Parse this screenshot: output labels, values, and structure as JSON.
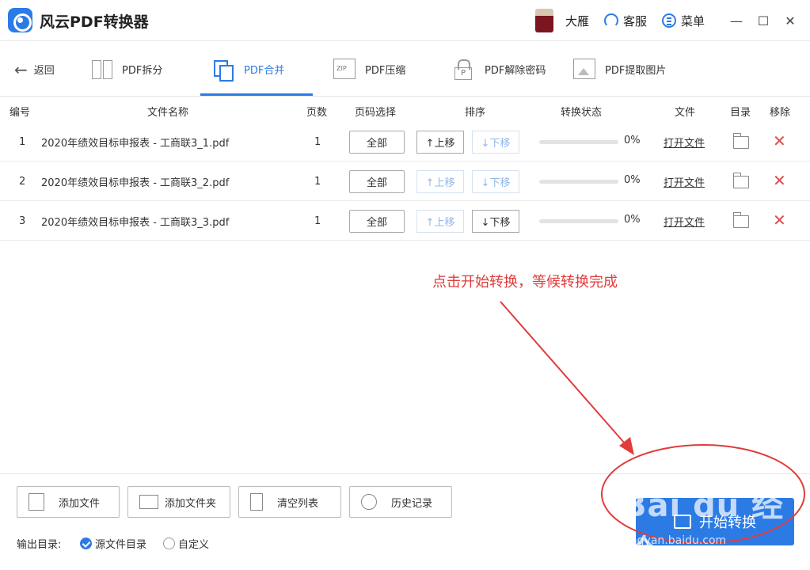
{
  "app": {
    "title": "风云PDF转换器",
    "user_name": "大雁",
    "service_label": "客服",
    "menu_label": "菜单",
    "minimize": "—",
    "maximize": "☐",
    "close": "✕"
  },
  "toolbar": {
    "back_label": "返回",
    "tabs": [
      {
        "label": "PDF拆分",
        "icon": "split-icon"
      },
      {
        "label": "PDF合并",
        "icon": "merge-icon",
        "active": true
      },
      {
        "label": "PDF压缩",
        "icon": "zip-icon"
      },
      {
        "label": "PDF解除密码",
        "icon": "lock-icon"
      },
      {
        "label": "PDF提取图片",
        "icon": "image-icon"
      }
    ]
  },
  "table": {
    "headers": {
      "index": "编号",
      "name": "文件名称",
      "pages": "页数",
      "page_select": "页码选择",
      "sort": "排序",
      "status": "转换状态",
      "file": "文件",
      "dir": "目录",
      "remove": "移除"
    },
    "rows": [
      {
        "index": "1",
        "name": "2020年绩效目标申报表 - 工商联3_1.pdf",
        "pages": "1",
        "page_select": "全部",
        "up": "↑上移",
        "down": "↓下移",
        "progress": 0,
        "percent": "0%",
        "open": "打开文件",
        "up_enabled": true,
        "down_enabled": false
      },
      {
        "index": "2",
        "name": "2020年绩效目标申报表 - 工商联3_2.pdf",
        "pages": "1",
        "page_select": "全部",
        "up": "↑上移",
        "down": "↓下移",
        "progress": 0,
        "percent": "0%",
        "open": "打开文件",
        "up_enabled": false,
        "down_enabled": false
      },
      {
        "index": "3",
        "name": "2020年绩效目标申报表 - 工商联3_3.pdf",
        "pages": "1",
        "page_select": "全部",
        "up": "↑上移",
        "down": "↓下移",
        "progress": 0,
        "percent": "0%",
        "open": "打开文件",
        "up_enabled": false,
        "down_enabled": true
      }
    ]
  },
  "annotation": {
    "text": "点击开始转换，等候转换完成",
    "color": "#e23b3b"
  },
  "footer": {
    "add_file": "添加文件",
    "add_folder": "添加文件夹",
    "clear_list": "清空列表",
    "history": "历史记录",
    "output_label": "输出目录:",
    "output_source": "源文件目录",
    "output_custom": "自定义",
    "start_label": "开始转换"
  },
  "watermark": {
    "brand": "Bai du 经验",
    "url": "jingyan.baidu.com"
  },
  "colors": {
    "accent": "#2c7be5",
    "remove": "#e04b4b"
  }
}
